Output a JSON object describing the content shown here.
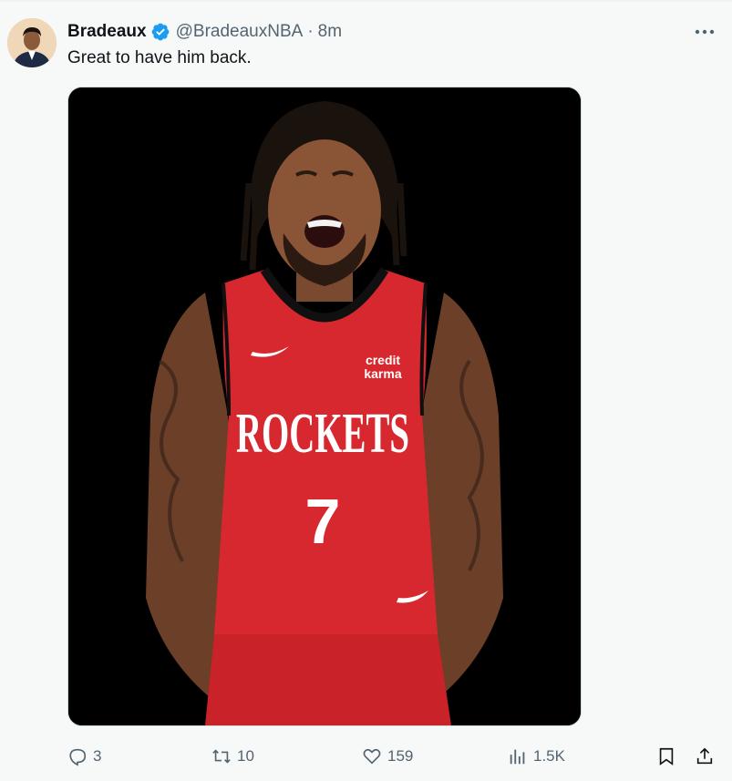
{
  "tweet": {
    "author_name": "Bradeaux",
    "handle": "@BradeauxNBA",
    "separator": "·",
    "time": "8m",
    "text": "Great to have him back.",
    "media": {
      "jersey_sponsor_line1": "credit",
      "jersey_sponsor_line2": "karma",
      "jersey_team": "ROCKETS",
      "jersey_number": "7",
      "jersey_color": "#d8282f",
      "background_color": "#000000"
    }
  },
  "icons": {
    "verified": "verified-badge-icon",
    "more": "more-options-icon",
    "reply": "reply-icon",
    "retweet": "retweet-icon",
    "like": "like-icon",
    "views": "views-icon",
    "bookmark": "bookmark-icon",
    "share": "share-icon"
  },
  "actions": {
    "replies": "3",
    "retweets": "10",
    "likes": "159",
    "views": "1.5K"
  },
  "colors": {
    "verified": "#1d9bf0",
    "secondary_text": "#536471",
    "primary_text": "#0f1419"
  }
}
